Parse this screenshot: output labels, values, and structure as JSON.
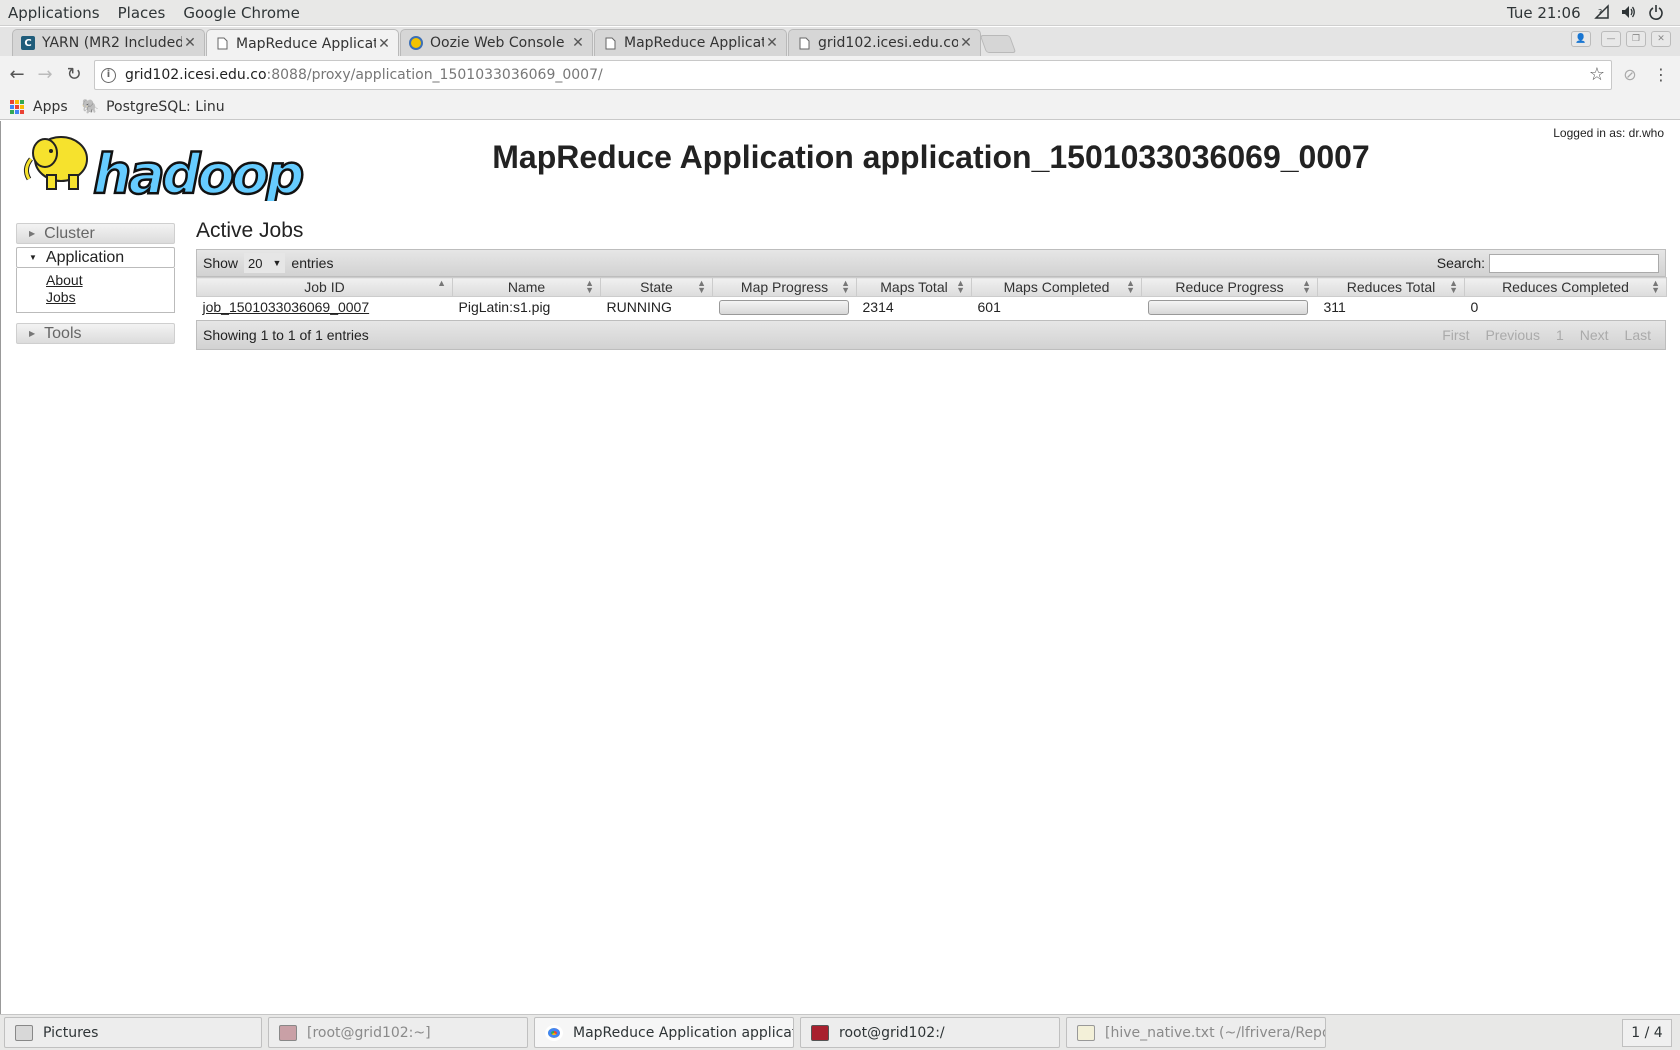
{
  "desktop": {
    "menus": [
      "Applications",
      "Places",
      "Google Chrome"
    ],
    "clock": "Tue 21:06"
  },
  "browser": {
    "tabs": [
      {
        "label": "YARN (MR2 Included",
        "icon": "cloudera-icon",
        "active": false
      },
      {
        "label": "MapReduce Applicat",
        "icon": "page-icon",
        "active": true
      },
      {
        "label": "Oozie Web Console",
        "icon": "oozie-icon",
        "active": false
      },
      {
        "label": "MapReduce Applicat",
        "icon": "page-icon",
        "active": false
      },
      {
        "label": "grid102.icesi.edu.co",
        "icon": "page-icon",
        "active": false
      }
    ],
    "url_host": "grid102.icesi.edu.co",
    "url_rest": ":8088/proxy/application_1501033036069_0007/",
    "bookmarks": [
      {
        "label": "Apps",
        "icon": "apps-grid-icon"
      },
      {
        "label": "PostgreSQL: Linu",
        "icon": "postgresql-icon"
      }
    ]
  },
  "page": {
    "title": "MapReduce Application application_1501033036069_0007",
    "logged_in": "Logged in as: dr.who",
    "logo_text": "hadoop",
    "nav": {
      "cluster": "Cluster",
      "application": "Application",
      "application_links": [
        "About",
        "Jobs"
      ],
      "tools": "Tools"
    },
    "section_title": "Active Jobs",
    "show_label": "Show",
    "show_value": "20",
    "entries_label": "entries",
    "search_label": "Search:",
    "columns": [
      "Job ID",
      "Name",
      "State",
      "Map Progress",
      "Maps Total",
      "Maps Completed",
      "Reduce Progress",
      "Reduces Total",
      "Reduces Completed"
    ],
    "rows": [
      {
        "job_id": "job_1501033036069_0007",
        "name": "PigLatin:s1.pig",
        "state": "RUNNING",
        "map_progress": 0,
        "maps_total": "2314",
        "maps_completed": "601",
        "reduce_progress": 0,
        "reduces_total": "311",
        "reduces_completed": "0"
      }
    ],
    "info": "Showing 1 to 1 of 1 entries",
    "pager": [
      "First",
      "Previous",
      "1",
      "Next",
      "Last"
    ]
  },
  "taskbar": {
    "items": [
      {
        "label": "Pictures",
        "dim": false
      },
      {
        "label": "[root@grid102:~]",
        "dim": true
      },
      {
        "label": "MapReduce Application application_...",
        "dim": false
      },
      {
        "label": "root@grid102:/",
        "dim": false
      },
      {
        "label": "[hive_native.txt (~/lfrivera/Repositor...",
        "dim": true
      }
    ],
    "workspace": "1 / 4"
  },
  "colors": {
    "hadoop_yellow": "#f6e22d",
    "hadoop_blue": "#66ccff",
    "progress_green": "#7fc24a"
  }
}
